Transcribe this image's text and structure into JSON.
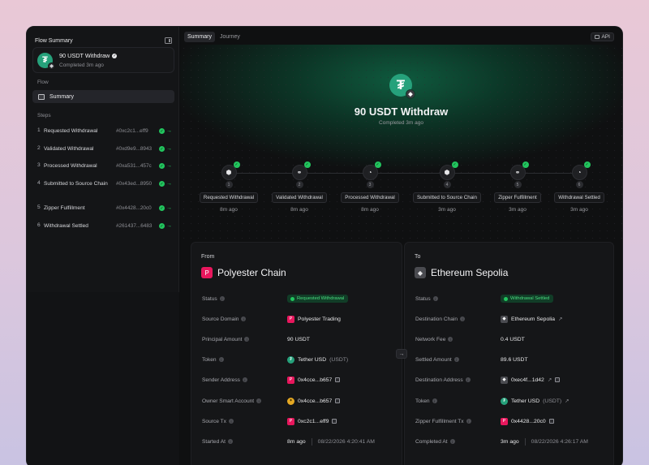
{
  "sidebar": {
    "title": "Flow Summary",
    "flow_card": {
      "name": "90 USDT Withdraw",
      "status": "Completed 3m ago"
    },
    "flow_section": "Flow",
    "summary_item": "Summary",
    "steps_section": "Steps",
    "steps": [
      {
        "num": "1",
        "label": "Requested Withdrawal",
        "hash": "#0xc2c1...eff9"
      },
      {
        "num": "2",
        "label": "Validated Withdrawal",
        "hash": "#0xd9e9...8943"
      },
      {
        "num": "3",
        "label": "Processed Withdrawal",
        "hash": "#0xa531...457c"
      },
      {
        "num": "4",
        "label": "Submitted to Source Chain",
        "hash": "#0x43ed...8950"
      },
      {
        "num": "5",
        "label": "Zipper Fulfillment",
        "hash": "#0x4428...20c0"
      },
      {
        "num": "6",
        "label": "Withdrawal Settled",
        "hash": "#261437...6483"
      }
    ]
  },
  "tabs": [
    {
      "label": "Summary",
      "active": true
    },
    {
      "label": "Journey",
      "active": false
    }
  ],
  "api_button": "API",
  "hero": {
    "title": "90 USDT Withdraw",
    "subtitle": "Completed 3m ago"
  },
  "journey": [
    {
      "num": "1",
      "label": "Requested Withdrawal",
      "time": "8m ago",
      "icon": "cube-icon"
    },
    {
      "num": "2",
      "label": "Validated Withdrawal",
      "time": "8m ago",
      "icon": "link-icon"
    },
    {
      "num": "3",
      "label": "Processed Withdrawal",
      "time": "8m ago",
      "icon": "gauge-icon"
    },
    {
      "num": "4",
      "label": "Submitted to Source Chain",
      "time": "3m ago",
      "icon": "cube-icon"
    },
    {
      "num": "5",
      "label": "Zipper Fulfillment",
      "time": "3m ago",
      "icon": "link-icon"
    },
    {
      "num": "6",
      "label": "Withdrawal Settled",
      "time": "3m ago",
      "icon": "gauge-icon"
    }
  ],
  "from": {
    "label": "From",
    "chain": "Polyester Chain",
    "rows": {
      "status": {
        "key": "Status",
        "value": "Requested Withdrawal"
      },
      "source_domain": {
        "key": "Source Domain",
        "value": "Polyester Trading"
      },
      "principal": {
        "key": "Principal Amount",
        "value": "90 USDT"
      },
      "token": {
        "key": "Token",
        "value": "Tether USD",
        "symbol": "(USDT)"
      },
      "sender": {
        "key": "Sender Address",
        "value": "0x4cce...b657"
      },
      "owner": {
        "key": "Owner Smart Account",
        "value": "0x4cce...b657"
      },
      "source_tx": {
        "key": "Source Tx",
        "value": "0xc2c1...eff9"
      },
      "started": {
        "key": "Started At",
        "value": "8m ago",
        "date": "08/22/2026 4:20:41 AM"
      }
    }
  },
  "to": {
    "label": "To",
    "chain": "Ethereum Sepolia",
    "rows": {
      "status": {
        "key": "Status",
        "value": "Withdrawal Settled"
      },
      "dest_chain": {
        "key": "Destination Chain",
        "value": "Ethereum Sepolia"
      },
      "fee": {
        "key": "Network Fee",
        "value": "0.4 USDT"
      },
      "settled": {
        "key": "Settled Amount",
        "value": "89.6 USDT"
      },
      "dest_addr": {
        "key": "Destination Address",
        "value": "0xec4f...1d42"
      },
      "token": {
        "key": "Token",
        "value": "Tether USD",
        "symbol": "(USDT)"
      },
      "zipper_tx": {
        "key": "Zipper Fulfillment Tx",
        "value": "0x4428...20c0"
      },
      "completed": {
        "key": "Completed At",
        "value": "3m ago",
        "date": "08/22/2026 4:26:17 AM"
      }
    }
  },
  "colors": {
    "accent": "#22c55e",
    "usdt": "#26a17b",
    "polyester": "#e8175d"
  }
}
